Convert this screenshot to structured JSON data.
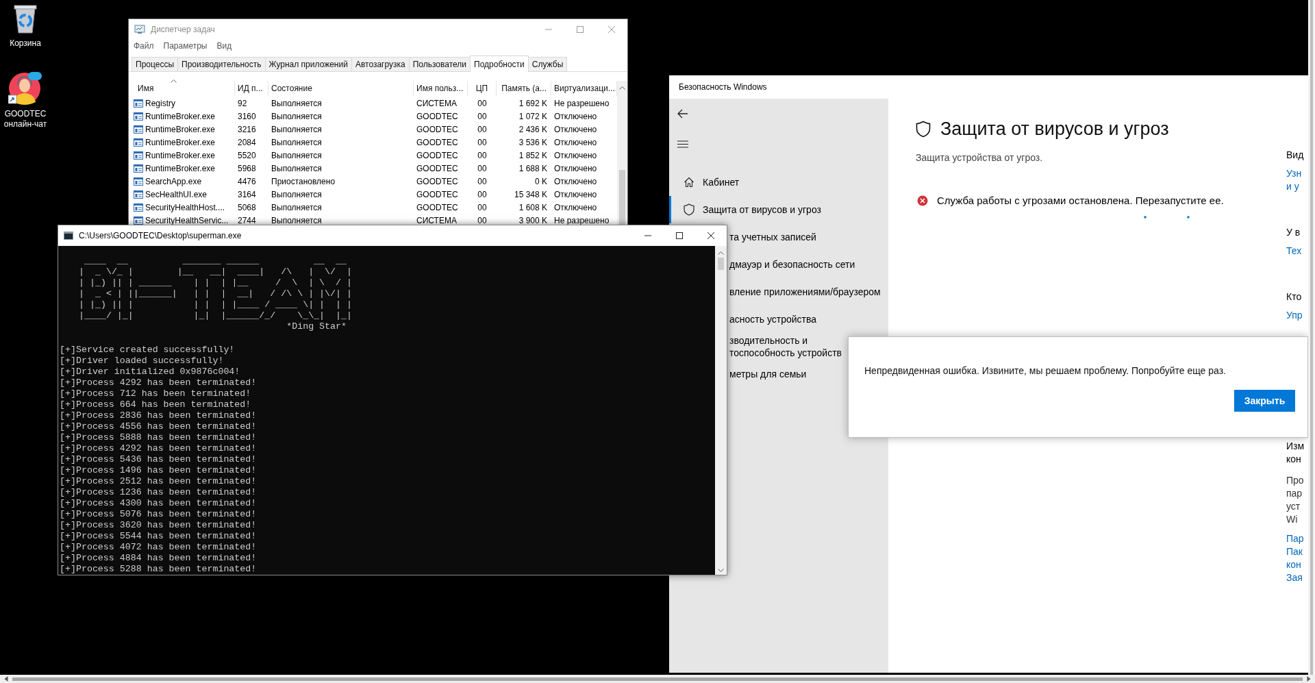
{
  "desktop_icons": [
    {
      "label": "Корзина",
      "kind": "recycle_bin"
    },
    {
      "label": "GOODTEC онлайн-чат",
      "kind": "chat_shortcut"
    }
  ],
  "task_manager": {
    "title": "Диспетчер задач",
    "menu": [
      "Файл",
      "Параметры",
      "Вид"
    ],
    "tabs": [
      {
        "label": "Процессы",
        "selected": false
      },
      {
        "label": "Производительность",
        "selected": false
      },
      {
        "label": "Журнал приложений",
        "selected": false
      },
      {
        "label": "Автозагрузка",
        "selected": false
      },
      {
        "label": "Пользователи",
        "selected": false
      },
      {
        "label": "Подробности",
        "selected": true
      },
      {
        "label": "Службы",
        "selected": false
      }
    ],
    "columns": [
      "Имя",
      "ИД п...",
      "Состояние",
      "Имя польз...",
      "ЦП",
      "Память (а...",
      "Виртуализаци..."
    ],
    "rows": [
      [
        "Registry",
        "92",
        "Выполняется",
        "СИСТЕМА",
        "00",
        "1 692 K",
        "Не разрешено"
      ],
      [
        "RuntimeBroker.exe",
        "3160",
        "Выполняется",
        "GOODTEC",
        "00",
        "1 072 K",
        "Отключено"
      ],
      [
        "RuntimeBroker.exe",
        "3216",
        "Выполняется",
        "GOODTEC",
        "00",
        "2 436 K",
        "Отключено"
      ],
      [
        "RuntimeBroker.exe",
        "2084",
        "Выполняется",
        "GOODTEC",
        "00",
        "3 536 K",
        "Отключено"
      ],
      [
        "RuntimeBroker.exe",
        "5520",
        "Выполняется",
        "GOODTEC",
        "00",
        "1 852 K",
        "Отключено"
      ],
      [
        "RuntimeBroker.exe",
        "5968",
        "Выполняется",
        "GOODTEC",
        "00",
        "1 688 K",
        "Отключено"
      ],
      [
        "SearchApp.exe",
        "4476",
        "Приостановлено",
        "GOODTEC",
        "00",
        "0 K",
        "Отключено"
      ],
      [
        "SecHealthUI.exe",
        "3164",
        "Выполняется",
        "GOODTEC",
        "00",
        "15 348 K",
        "Отключено"
      ],
      [
        "SecurityHealthHost....",
        "5068",
        "Выполняется",
        "GOODTEC",
        "00",
        "1 608 K",
        "Отключено"
      ],
      [
        "SecurityHealthServic...",
        "2744",
        "Выполняется",
        "СИСТЕМА",
        "00",
        "3 900 K",
        "Не разрешено"
      ]
    ]
  },
  "security": {
    "title": "Безопасность Windows",
    "nav": [
      {
        "label": "Кабинет",
        "kind": "home",
        "selected": false
      },
      {
        "label": "Защита от вирусов и угроз",
        "kind": "shield",
        "selected": true
      },
      {
        "label": "та учетных записей",
        "kind": "covered",
        "selected": false
      },
      {
        "label": "дмауэр и безопасность сети",
        "kind": "covered",
        "selected": false
      },
      {
        "label": "вление приложениями/браузером",
        "kind": "covered",
        "selected": false
      },
      {
        "label": "асность устройства",
        "kind": "covered",
        "selected": false
      },
      {
        "label": "зводительность и\nтоспособность устройств",
        "kind": "covered",
        "selected": false
      },
      {
        "label": "метры для семьи",
        "kind": "covered",
        "selected": false
      }
    ],
    "heading": "Защита от вирусов и угроз",
    "subtitle": "Защита устройства от угроз.",
    "alert": "Служба работы с угрозами остановлена. Перезапустите ее.",
    "right_column": [
      [
        {
          "text": "Вид",
          "kind": "heading"
        },
        {
          "text": "Узн",
          "kind": "link"
        },
        {
          "text": "и у",
          "kind": "link"
        }
      ],
      [
        {
          "text": "У в",
          "kind": "heading"
        },
        {
          "text": "Тех",
          "kind": "link"
        }
      ],
      [
        {
          "text": "Кто",
          "kind": "heading"
        },
        {
          "text": "Упр",
          "kind": "link"
        }
      ],
      [
        {
          "text": "Изм",
          "kind": "heading"
        },
        {
          "text": "кон",
          "kind": "heading"
        },
        {
          "text": "Про",
          "kind": "text"
        },
        {
          "text": "пар",
          "kind": "text"
        },
        {
          "text": "уст",
          "kind": "text"
        },
        {
          "text": "Wi",
          "kind": "text"
        },
        {
          "text": "Пар",
          "kind": "link"
        },
        {
          "text": "Пак",
          "kind": "link"
        },
        {
          "text": "кон",
          "kind": "link"
        },
        {
          "text": "Зая",
          "kind": "link"
        }
      ]
    ],
    "dialog": {
      "message": "Непредвиденная ошибка. Извините, мы решаем проблему. Попробуйте еще раз.",
      "button": "Закрыть"
    }
  },
  "console": {
    "title": "C:\\Users\\GOODTEC\\Desktop\\superman.exe",
    "banner": [
      " ____  __          _______ ______          __  __ ",
      "|  _ \\/_ |        |__   __|  ____|   /\\   |  \\/  |",
      "| |_) || | ______    | |  | |__     /  \\  | \\  / |",
      "|  _ < | ||______|   | |  |  __|   / /\\ \\ | |\\/| |",
      "| |_) || |           | |  | |____ / ____ \\| |  | |",
      "|____/ |_|           |_|  |______/_/    \\_\\_|  |_|",
      "                                      *Ding Star*"
    ],
    "output": [
      "[+]Service created successfully!",
      "[+]Driver loaded successfully!",
      "[+]Driver initialized 0x9876c004!",
      "[+]Process 4292 has been terminated!",
      "[+]Process 712 has been terminated!",
      "[+]Process 664 has been terminated!",
      "[+]Process 2836 has been terminated!",
      "[+]Process 4556 has been terminated!",
      "[+]Process 5888 has been terminated!",
      "[+]Process 4292 has been terminated!",
      "[+]Process 5436 has been terminated!",
      "[+]Process 1496 has been terminated!",
      "[+]Process 2512 has been terminated!",
      "[+]Process 1236 has been terminated!",
      "[+]Process 4300 has been terminated!",
      "[+]Process 5076 has been terminated!",
      "[+]Process 3620 has been terminated!",
      "[+]Process 5544 has been terminated!",
      "[+]Process 4072 has been terminated!",
      "[+]Process 4884 has been terminated!",
      "[+]Process 5288 has been terminated!"
    ]
  }
}
